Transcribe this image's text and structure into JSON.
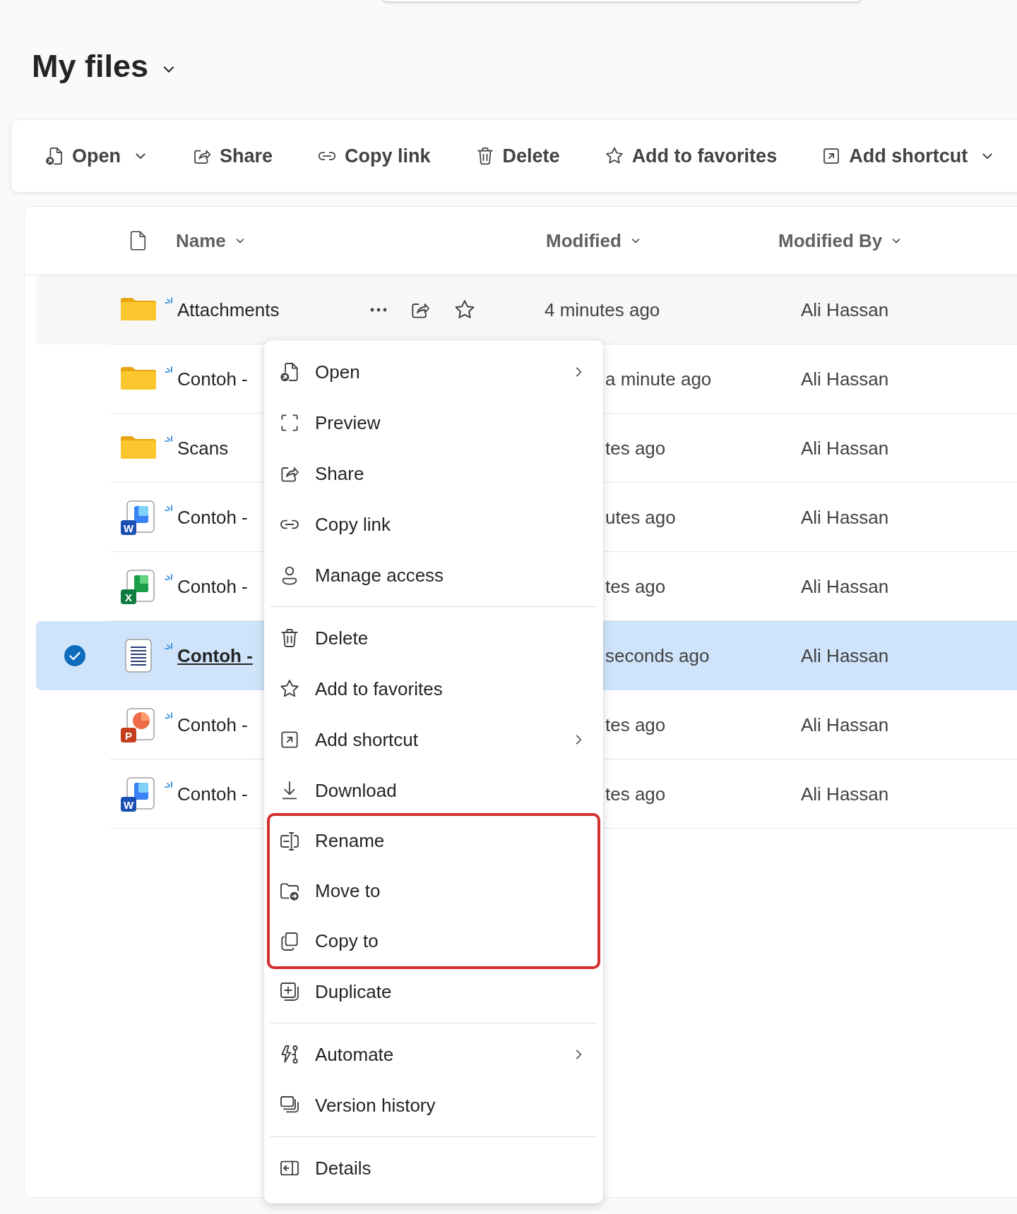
{
  "header": {
    "title": "My files"
  },
  "toolbar": [
    {
      "label": "Open",
      "dropdown": true
    },
    {
      "label": "Share",
      "dropdown": false
    },
    {
      "label": "Copy link",
      "dropdown": false
    },
    {
      "label": "Delete",
      "dropdown": false
    },
    {
      "label": "Add to favorites",
      "dropdown": false
    },
    {
      "label": "Add shortcut",
      "dropdown": true
    }
  ],
  "table": {
    "columns": [
      {
        "label": "Name"
      },
      {
        "label": "Modified"
      },
      {
        "label": "Modified By"
      }
    ],
    "rows": [
      {
        "kind": "folder",
        "name": "Attachments",
        "modified": "4 minutes ago",
        "modified_by": "Ali Hassan",
        "new": true,
        "selected": false,
        "hovered": true
      },
      {
        "kind": "folder",
        "name": "Contoh -",
        "modified": "a minute ago",
        "modified_by": "Ali Hassan",
        "new": true,
        "selected": false,
        "hovered": false
      },
      {
        "kind": "folder",
        "name": "Scans",
        "modified": "tes ago",
        "modified_by": "Ali Hassan",
        "new": true,
        "selected": false,
        "hovered": false
      },
      {
        "kind": "document",
        "icon_letter": "W",
        "name": "Contoh -",
        "modified": "utes ago",
        "modified_by": "Ali Hassan",
        "new": true,
        "selected": false,
        "hovered": false
      },
      {
        "kind": "spreadsheet",
        "icon_letter": "X",
        "name": "Contoh -",
        "modified": "tes ago",
        "modified_by": "Ali Hassan",
        "new": true,
        "selected": false,
        "hovered": false
      },
      {
        "kind": "text",
        "name": "Contoh -",
        "modified": "seconds ago",
        "modified_by": "Ali Hassan",
        "new": true,
        "selected": true,
        "hovered": false
      },
      {
        "kind": "presentation",
        "icon_letter": "P",
        "name": "Contoh -",
        "modified": "tes ago",
        "modified_by": "Ali Hassan",
        "new": true,
        "selected": false,
        "hovered": false
      },
      {
        "kind": "document",
        "icon_letter": "W",
        "name": "Contoh -",
        "modified": "tes ago",
        "modified_by": "Ali Hassan",
        "new": true,
        "selected": false,
        "hovered": false
      }
    ]
  },
  "context_menu": {
    "items": [
      {
        "label": "Open",
        "submenu": true,
        "separator_before": false,
        "highlighted": false
      },
      {
        "label": "Preview",
        "submenu": false,
        "separator_before": false,
        "highlighted": false
      },
      {
        "label": "Share",
        "submenu": false,
        "separator_before": false,
        "highlighted": false
      },
      {
        "label": "Copy link",
        "submenu": false,
        "separator_before": false,
        "highlighted": false
      },
      {
        "label": "Manage access",
        "submenu": false,
        "separator_before": false,
        "highlighted": false
      },
      {
        "label": "Delete",
        "submenu": false,
        "separator_before": true,
        "highlighted": false
      },
      {
        "label": "Add to favorites",
        "submenu": false,
        "separator_before": false,
        "highlighted": false
      },
      {
        "label": "Add shortcut",
        "submenu": true,
        "separator_before": false,
        "highlighted": false
      },
      {
        "label": "Download",
        "submenu": false,
        "separator_before": false,
        "highlighted": false
      },
      {
        "label": "Rename",
        "submenu": false,
        "separator_before": false,
        "highlighted": true
      },
      {
        "label": "Move to",
        "submenu": false,
        "separator_before": false,
        "highlighted": true
      },
      {
        "label": "Copy to",
        "submenu": false,
        "separator_before": false,
        "highlighted": true
      },
      {
        "label": "Duplicate",
        "submenu": false,
        "separator_before": false,
        "highlighted": false
      },
      {
        "label": "Automate",
        "submenu": true,
        "separator_before": true,
        "highlighted": false
      },
      {
        "label": "Version history",
        "submenu": false,
        "separator_before": false,
        "highlighted": false
      },
      {
        "label": "Details",
        "submenu": false,
        "separator_before": true,
        "highlighted": false
      }
    ]
  }
}
